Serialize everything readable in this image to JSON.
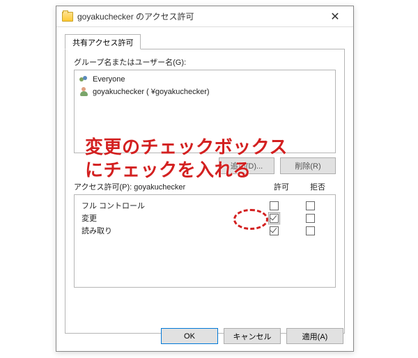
{
  "window": {
    "title": "goyakuchecker のアクセス許可"
  },
  "tab": {
    "label": "共有アクセス許可"
  },
  "groupLabel": "グループ名またはユーザー名(G):",
  "list": {
    "items": [
      {
        "label": "Everyone"
      },
      {
        "label": "goyakuchecker (                   ¥goyakuchecker)"
      }
    ]
  },
  "buttons": {
    "add": "追加(D)...",
    "remove": "削除(R)"
  },
  "permHeader": {
    "title": "アクセス許可(P): goyakuchecker",
    "allow": "許可",
    "deny": "拒否"
  },
  "perms": {
    "rows": [
      {
        "label": "フル コントロール",
        "allow": false,
        "deny": false
      },
      {
        "label": "変更",
        "allow": true,
        "deny": false,
        "focus": true
      },
      {
        "label": "読み取り",
        "allow": true,
        "deny": false
      }
    ]
  },
  "dlgButtons": {
    "ok": "OK",
    "cancel": "キャンセル",
    "apply": "適用(A)"
  },
  "annotation": {
    "line1": "変更のチェックボックス",
    "line2": "にチェックを入れる"
  }
}
